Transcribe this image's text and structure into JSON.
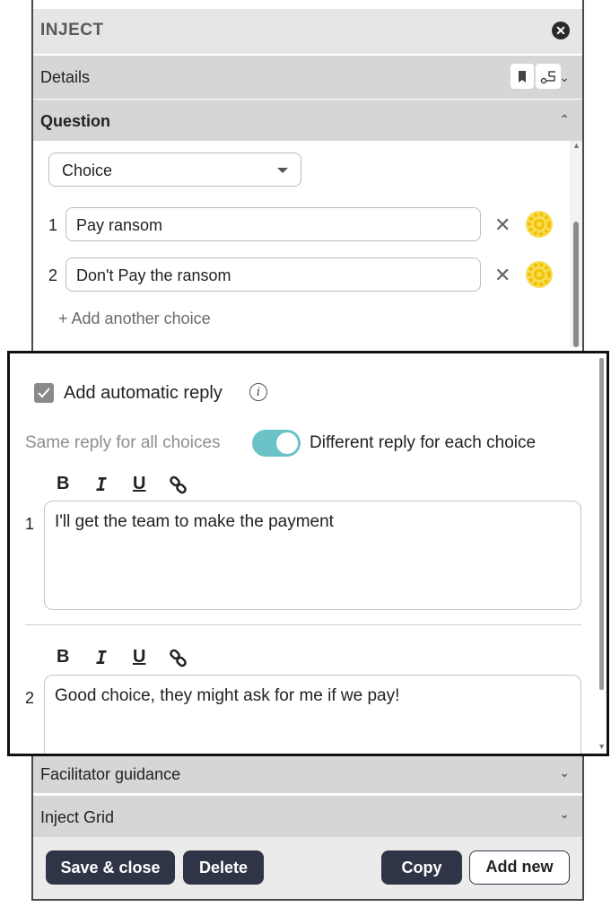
{
  "panel": {
    "title": "INJECT",
    "close_icon": "close-icon"
  },
  "sections": {
    "details": "Details",
    "question": "Question",
    "facilitator": "Facilitator guidance",
    "grid": "Inject Grid"
  },
  "question": {
    "type_value": "Choice",
    "choices": [
      {
        "number": "1",
        "text": "Pay ransom"
      },
      {
        "number": "2",
        "text": "Don't Pay the ransom"
      }
    ],
    "add_choice": "+ Add another choice"
  },
  "reply": {
    "auto_label": "Add automatic reply",
    "info_glyph": "i",
    "same_label": "Same reply for all choices",
    "different_label": "Different reply for each choice",
    "toggle_on": true,
    "toolbar": {
      "bold": "B",
      "italic": "I",
      "underline": "U",
      "link_icon": "link-icon"
    },
    "replies": [
      {
        "number": "1",
        "text": "I'll get the team to make the payment"
      },
      {
        "number": "2",
        "text": "Good choice, they might ask for me if we pay!"
      }
    ]
  },
  "footer": {
    "save_close": "Save & close",
    "delete": "Delete",
    "copy": "Copy",
    "add_new": "Add new"
  },
  "colors": {
    "accent_toggle": "#6cc3c7",
    "button_dark": "#2f3547",
    "gear_yellow": "#f2c200"
  }
}
